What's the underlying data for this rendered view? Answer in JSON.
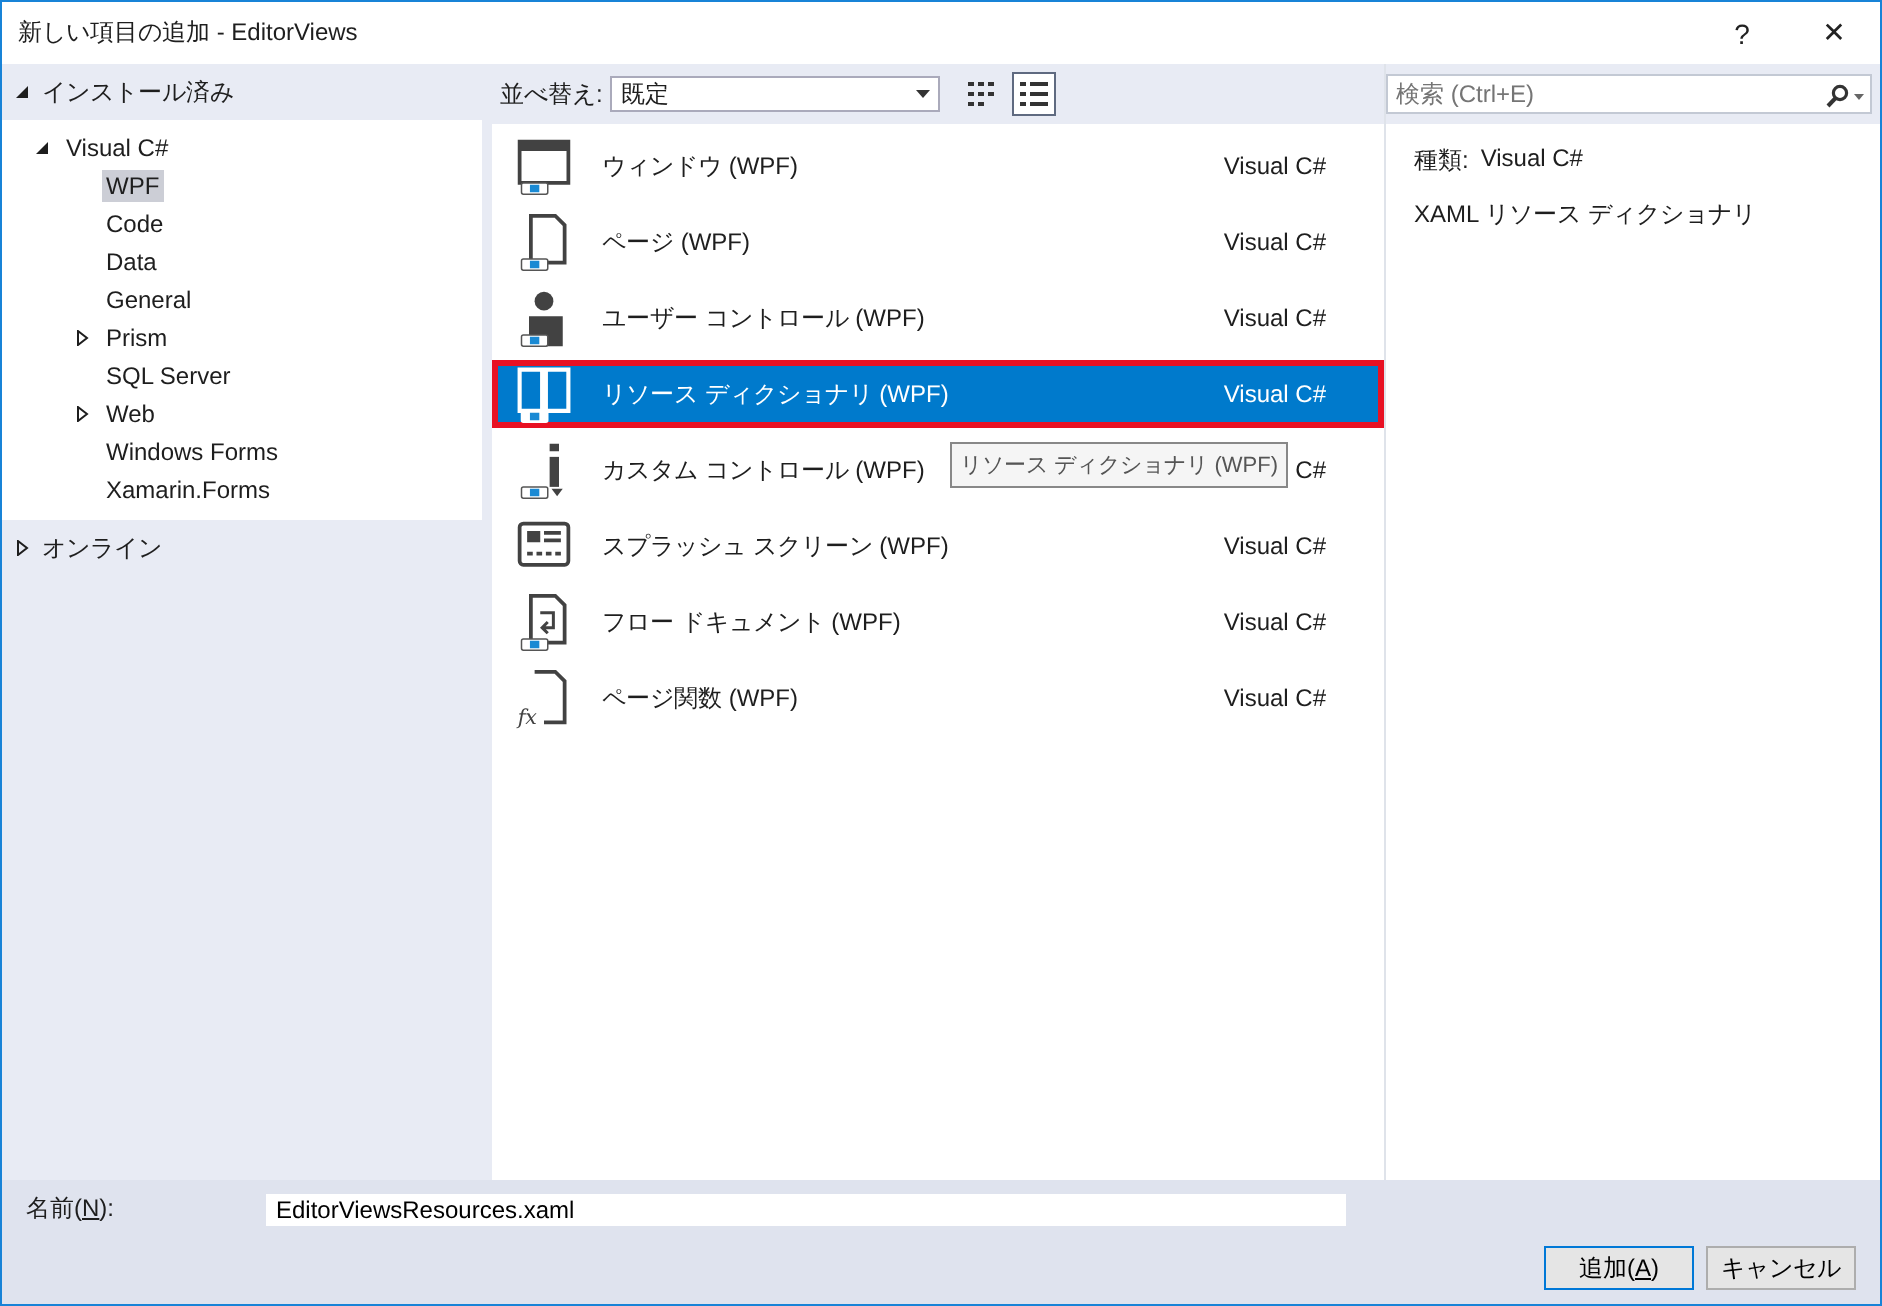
{
  "window": {
    "title": "新しい項目の追加 - EditorViews",
    "buttons": [
      "?",
      "✕"
    ]
  },
  "sidebar": {
    "sections": [
      {
        "label": "インストール済み",
        "expanded": true,
        "children": [
          {
            "label": "Visual C#",
            "expanded": true,
            "children": [
              {
                "label": "WPF",
                "selected": true
              },
              {
                "label": "Code",
                "selected": false
              },
              {
                "label": "Data",
                "selected": false
              },
              {
                "label": "General",
                "selected": false
              },
              {
                "label": "Prism",
                "selected": false,
                "expanded": false
              },
              {
                "label": "SQL Server",
                "selected": false
              },
              {
                "label": "Web",
                "selected": false,
                "expanded": false
              },
              {
                "label": "Windows Forms",
                "selected": false
              },
              {
                "label": "Xamarin.Forms",
                "selected": false
              }
            ]
          }
        ]
      },
      {
        "label": "オンライン",
        "expanded": false
      }
    ]
  },
  "toolbar": {
    "sort_label": "並べ替え:",
    "sort_value": "既定",
    "views": [
      {
        "kind": "small-icons",
        "selected": false
      },
      {
        "kind": "details",
        "selected": true
      }
    ]
  },
  "templates": [
    {
      "kind": "window",
      "name": "ウィンドウ (WPF)",
      "category": "Visual C#",
      "selected": false,
      "outlined": false
    },
    {
      "kind": "page",
      "name": "ページ (WPF)",
      "category": "Visual C#",
      "selected": false,
      "outlined": false
    },
    {
      "kind": "user-control",
      "name": "ユーザー コントロール (WPF)",
      "category": "Visual C#",
      "selected": false,
      "outlined": false
    },
    {
      "kind": "dictionary",
      "name": "リソース ディクショナリ (WPF)",
      "category": "Visual C#",
      "selected": true,
      "outlined": true
    },
    {
      "kind": "custom-control",
      "name": "カスタム コントロール (WPF)",
      "category": "C#",
      "selected": false,
      "outlined": false
    },
    {
      "kind": "splash",
      "name": "スプラッシュ スクリーン (WPF)",
      "category": "Visual C#",
      "selected": false,
      "outlined": false
    },
    {
      "kind": "flow-doc",
      "name": "フロー ドキュメント (WPF)",
      "category": "Visual C#",
      "selected": false,
      "outlined": false
    },
    {
      "kind": "page-function",
      "icon_text": "fx",
      "name": "ページ関数 (WPF)",
      "category": "Visual C#",
      "selected": false,
      "outlined": false
    }
  ],
  "tooltip": "リソース ディクショナリ (WPF)",
  "search": {
    "placeholder": "検索 (Ctrl+E)"
  },
  "details": {
    "type_label": "種類:",
    "type_value": "Visual C#",
    "description": "XAML リソース ディクショナリ"
  },
  "name_field": {
    "label_before": "名前(",
    "accesskey": "N",
    "label_after": "):",
    "value": "EditorViewsResources.xaml"
  },
  "buttons": [
    {
      "before": "追加(",
      "accesskey": "A",
      "after": ")",
      "default": true
    },
    {
      "before": "キャンセル",
      "default": false
    }
  ]
}
